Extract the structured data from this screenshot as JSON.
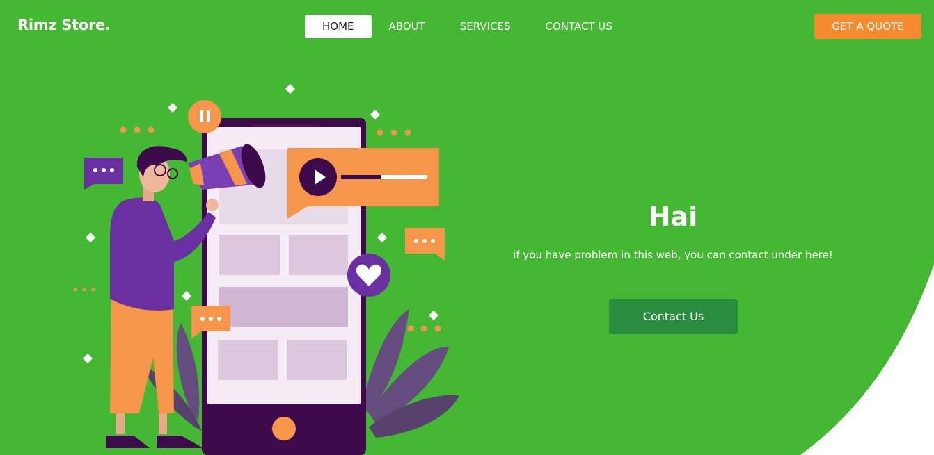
{
  "colors": {
    "primary": "#44b833",
    "accent": "#f58b2e",
    "purple": "#5f2c99",
    "button": "#2a8c3d"
  },
  "nav": {
    "brand": "Rimz Store.",
    "links": [
      {
        "label": "HOME",
        "active": true
      },
      {
        "label": "ABOUT",
        "active": false
      },
      {
        "label": "SERVICES",
        "active": false
      },
      {
        "label": "CONTACT US",
        "active": false
      }
    ],
    "quote_label": "GET A QUOTE"
  },
  "hero": {
    "title": "Hai",
    "subtitle": "if you have problem in this web, you can contact under here!",
    "button_label": "Contact Us"
  },
  "illustration": {
    "icons": [
      "megaphone-icon",
      "play-icon",
      "pause-icon",
      "heart-icon",
      "chat-bubble-icon"
    ]
  }
}
